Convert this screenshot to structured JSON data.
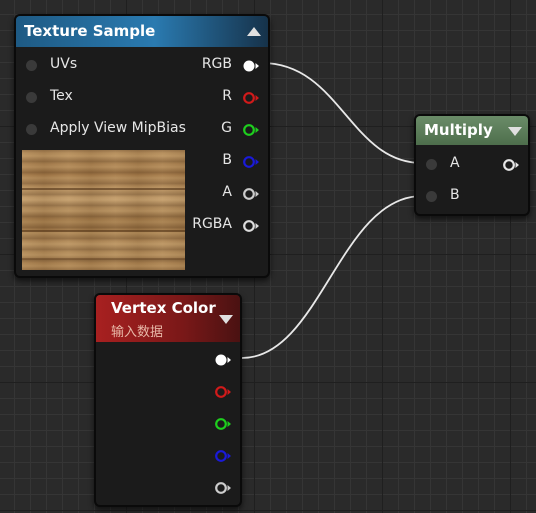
{
  "texture_sample": {
    "title": "Texture Sample",
    "inputs": [
      {
        "label": "UVs"
      },
      {
        "label": "Tex"
      },
      {
        "label": "Apply View MipBias"
      }
    ],
    "outputs": [
      {
        "label": "RGB",
        "color": "#ffffff"
      },
      {
        "label": "R",
        "color": "#d11a1a"
      },
      {
        "label": "G",
        "color": "#1ecf1e"
      },
      {
        "label": "B",
        "color": "#1a1ad8"
      },
      {
        "label": "A",
        "color": "#cccccc"
      },
      {
        "label": "RGBA",
        "color": "#dddddd"
      }
    ],
    "header_color": "#1e5a84",
    "preview": "wood-texture"
  },
  "multiply": {
    "title": "Multiply",
    "inputs": [
      {
        "label": "A"
      },
      {
        "label": "B"
      }
    ],
    "header_color": "#5a7a58"
  },
  "vertex_color": {
    "title": "Vertex Color",
    "subtitle": "输入数据",
    "header_color": "#8e1c1c",
    "outputs": [
      {
        "color": "#ffffff"
      },
      {
        "color": "#d11a1a"
      },
      {
        "color": "#1ecf1e"
      },
      {
        "color": "#1a1ad8"
      },
      {
        "color": "#cccccc"
      }
    ]
  },
  "wires": [
    {
      "from": "Texture Sample.RGB",
      "to": "Multiply.A"
    },
    {
      "from": "Vertex Color.RGB",
      "to": "Multiply.B"
    }
  ]
}
